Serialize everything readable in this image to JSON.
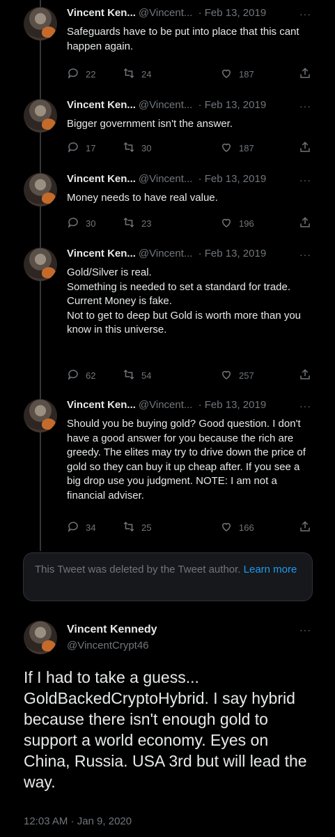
{
  "thread": [
    {
      "name": "Vincent Ken...",
      "handle": "@Vincent...",
      "date": "· Feb 13, 2019",
      "text": "Safeguards have to be put into place that this cant happen again.",
      "replies": "22",
      "retweets": "24",
      "likes": "187"
    },
    {
      "name": "Vincent Ken...",
      "handle": "@Vincent...",
      "date": "· Feb 13, 2019",
      "text": "Bigger government isn't the answer.",
      "replies": "17",
      "retweets": "30",
      "likes": "187"
    },
    {
      "name": "Vincent Ken...",
      "handle": "@Vincent...",
      "date": "· Feb 13, 2019",
      "text": "Money needs to have real value.",
      "replies": "30",
      "retweets": "23",
      "likes": "196"
    },
    {
      "name": "Vincent Ken...",
      "handle": "@Vincent...",
      "date": "· Feb 13, 2019",
      "text": "Gold/Silver is real.\nSomething is needed to set a standard for trade.\nCurrent Money is fake.\nNot to get to deep but Gold is worth more than you know in this universe.",
      "replies": "62",
      "retweets": "54",
      "likes": "257"
    },
    {
      "name": "Vincent Ken...",
      "handle": "@Vincent...",
      "date": "· Feb 13, 2019",
      "text": "Should you be buying gold? Good question. I don't have a good answer for you because the rich are greedy. The elites may try to drive down the price of gold so they can buy it up cheap after. If you see a big drop use you judgment. NOTE: I am not a financial adviser.",
      "replies": "34",
      "retweets": "25",
      "likes": "166"
    }
  ],
  "deleted_notice": {
    "text": "This Tweet was deleted by the Tweet author.",
    "link": "Learn more"
  },
  "main_tweet": {
    "name": "Vincent Kennedy",
    "handle": "@VincentCrypt46",
    "text": "If I had to take a guess... GoldBackedCryptoHybrid. I say hybrid because there isn't enough gold to support a world economy. Eyes on China, Russia. USA 3rd but will lead the way.",
    "timestamp": "12:03 AM · Jan 9, 2020"
  },
  "colors": {
    "background": "#000000",
    "muted": "#71767b",
    "link": "#1d9bf0"
  }
}
